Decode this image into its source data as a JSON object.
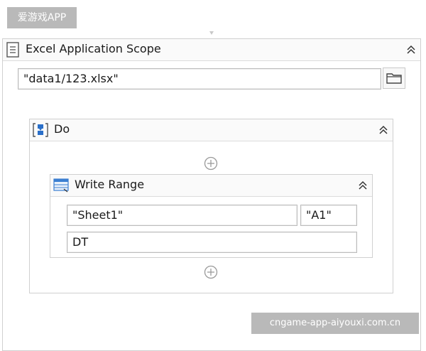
{
  "watermarks": {
    "top": "爱游戏APP",
    "bottom": "cngame-app-aiyouxi.com.cn"
  },
  "scope": {
    "title": "Excel Application Scope",
    "path_value": "\"data1/123.xlsx\""
  },
  "do_block": {
    "title": "Do"
  },
  "write_range": {
    "title": "Write Range",
    "sheet_value": "\"Sheet1\"",
    "cell_value": "\"A1\"",
    "datatable_value": "DT"
  }
}
